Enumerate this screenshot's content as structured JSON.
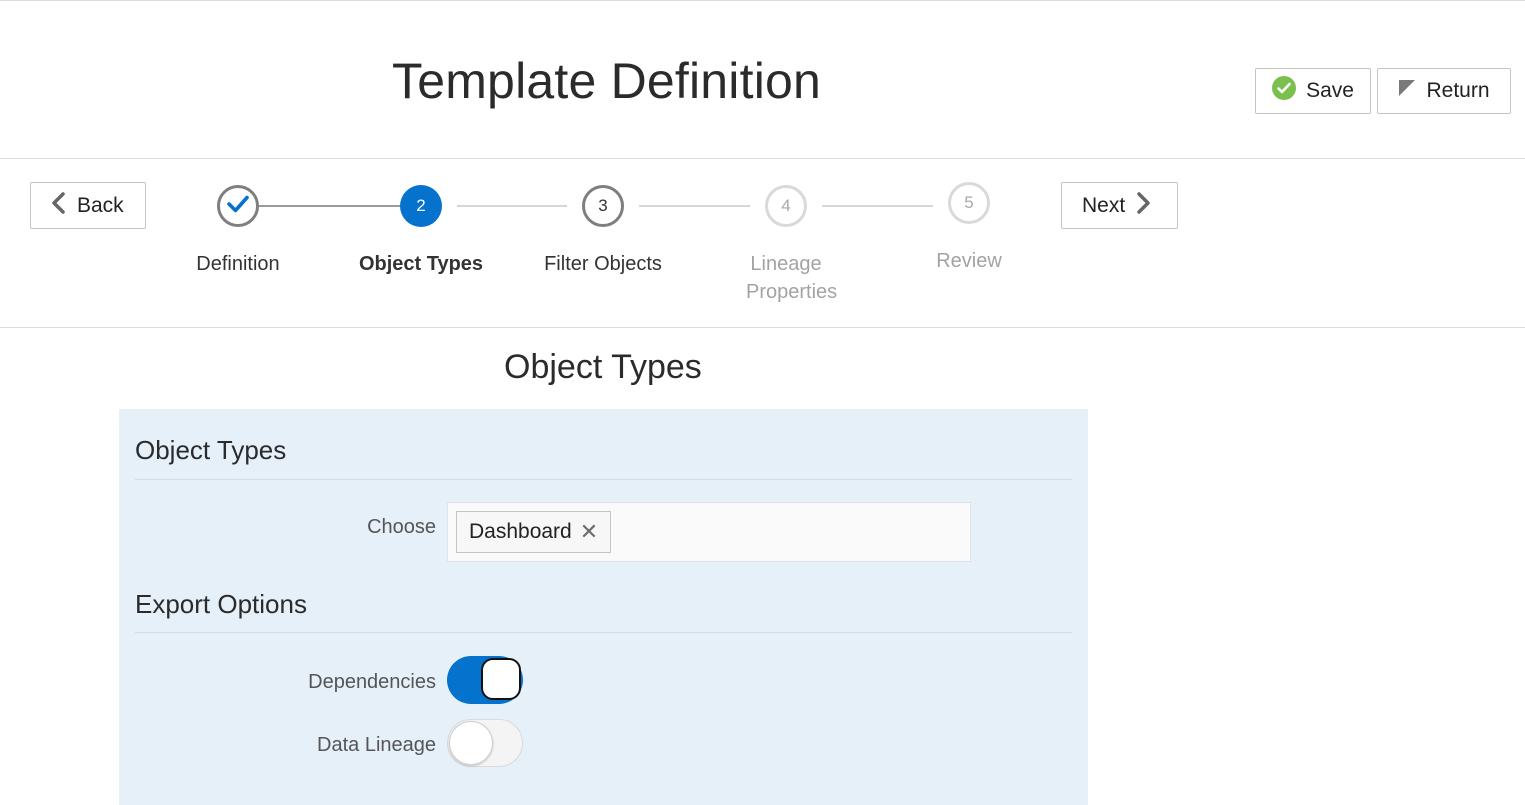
{
  "header": {
    "title": "Template Definition",
    "save_label": "Save",
    "return_label": "Return"
  },
  "navigation": {
    "back_label": "Back",
    "next_label": "Next"
  },
  "train": {
    "steps": [
      {
        "number": "",
        "label": "Definition",
        "state": "visited"
      },
      {
        "number": "2",
        "label": "Object Types",
        "state": "current"
      },
      {
        "number": "3",
        "label": "Filter Objects",
        "state": "unvisited"
      },
      {
        "number": "4",
        "label": "Lineage Properties",
        "state": "disabled"
      },
      {
        "number": "5",
        "label": "Review",
        "state": "disabled"
      }
    ]
  },
  "main": {
    "section_title": "Object Types",
    "object_types": {
      "heading": "Object Types",
      "choose_label": "Choose",
      "selected": [
        "Dashboard"
      ]
    },
    "export_options": {
      "heading": "Export Options",
      "dependencies_label": "Dependencies",
      "dependencies_on": true,
      "data_lineage_label": "Data Lineage",
      "data_lineage_on": false
    }
  },
  "colors": {
    "accent": "#0572ce",
    "panel_bg": "#e6f0f9",
    "success": "#7bbf4f"
  }
}
